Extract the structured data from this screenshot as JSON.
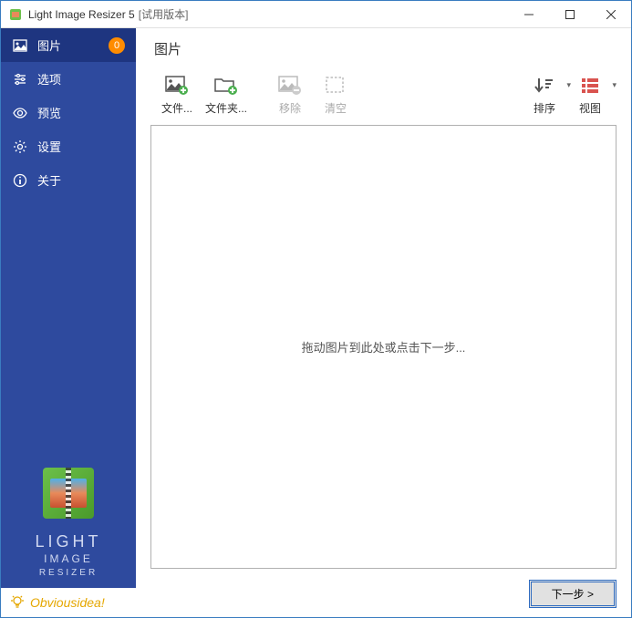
{
  "titlebar": {
    "app_name": "Light Image Resizer 5",
    "suffix": "[试用版本]"
  },
  "sidebar": {
    "items": [
      {
        "label": "图片",
        "badge": "0"
      },
      {
        "label": "选项"
      },
      {
        "label": "预览"
      },
      {
        "label": "设置"
      },
      {
        "label": "关于"
      }
    ],
    "brand": {
      "line1": "LIGHT",
      "line2": "IMAGE",
      "line3": "RESIZER"
    },
    "obvious": "Obviousidea!"
  },
  "page": {
    "title": "图片"
  },
  "toolbar": {
    "files": "文件...",
    "folder": "文件夹...",
    "remove": "移除",
    "clear": "清空",
    "sort": "排序",
    "view": "视图"
  },
  "drop": {
    "placeholder": "拖动图片到此处或点击下一步..."
  },
  "footer": {
    "next": "下一步 >"
  }
}
